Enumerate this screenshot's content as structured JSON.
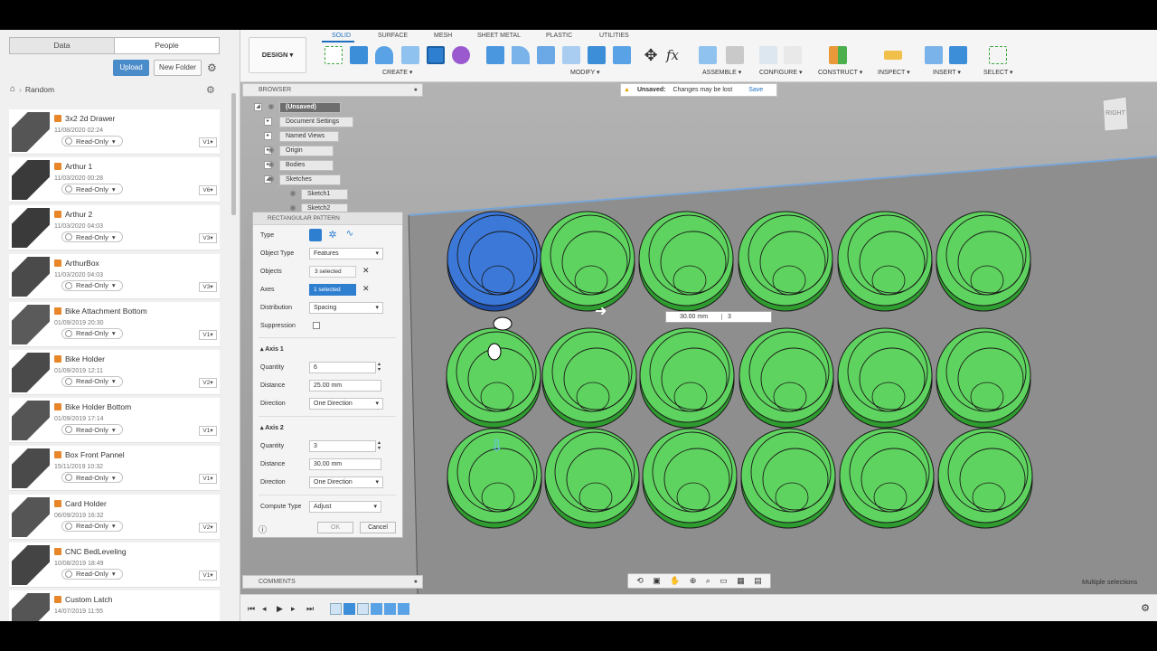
{
  "data_panel": {
    "tab_data": "Data",
    "tab_people": "People",
    "upload": "Upload",
    "new_folder": "New Folder",
    "breadcrumb": "Random",
    "files": [
      {
        "name": "3x2 2d Drawer",
        "date": "11/08/2020 02:24",
        "status": "Read-Only",
        "version": "V1"
      },
      {
        "name": "Arthur 1",
        "date": "11/03/2020 00:28",
        "status": "Read-Only",
        "version": "V6"
      },
      {
        "name": "Arthur 2",
        "date": "11/03/2020 04:03",
        "status": "Read-Only",
        "version": "V3"
      },
      {
        "name": "ArthurBox",
        "date": "11/03/2020 04:03",
        "status": "Read-Only",
        "version": "V3"
      },
      {
        "name": "Bike Attachment Bottom",
        "date": "01/09/2019 20:30",
        "status": "Read-Only",
        "version": "V1"
      },
      {
        "name": "Bike Holder",
        "date": "01/09/2019 12:11",
        "status": "Read-Only",
        "version": "V2"
      },
      {
        "name": "Bike Holder Bottom",
        "date": "01/09/2019 17:14",
        "status": "Read-Only",
        "version": "V1"
      },
      {
        "name": "Box Front Pannel",
        "date": "15/11/2019 10:32",
        "status": "Read-Only",
        "version": "V1"
      },
      {
        "name": "Card Holder",
        "date": "06/09/2019 16:32",
        "status": "Read-Only",
        "version": "V2"
      },
      {
        "name": "CNC BedLeveling",
        "date": "10/08/2019 18:49",
        "status": "Read-Only",
        "version": "V1"
      },
      {
        "name": "Custom Latch",
        "date": "14/07/2019 11:55",
        "status": "",
        "version": ""
      }
    ]
  },
  "toolbar": {
    "design": "DESIGN",
    "tabs": [
      "SOLID",
      "SURFACE",
      "MESH",
      "SHEET METAL",
      "PLASTIC",
      "UTILITIES"
    ],
    "groups": [
      "CREATE",
      "MODIFY",
      "ASSEMBLE",
      "CONFIGURE",
      "CONSTRUCT",
      "INSPECT",
      "INSERT",
      "SELECT"
    ]
  },
  "browser": {
    "title": "BROWSER",
    "nodes": [
      "(Unsaved)",
      "Document Settings",
      "Named Views",
      "Origin",
      "Bodies",
      "Sketches",
      "Sketch1",
      "Sketch2"
    ]
  },
  "pattern": {
    "title": "RECTANGULAR PATTERN",
    "type_label": "Type",
    "object_type_label": "Object Type",
    "object_type": "Features",
    "objects_label": "Objects",
    "objects": "3 selected",
    "axes_label": "Axes",
    "axes": "1 selected",
    "distribution_label": "Distribution",
    "distribution": "Spacing",
    "suppression_label": "Suppression",
    "axis1": "Axis 1",
    "axis2": "Axis 2",
    "quantity_label": "Quantity",
    "distance_label": "Distance",
    "direction_label": "Direction",
    "q1": "6",
    "d1": "25.00 mm",
    "dir1": "One Direction",
    "q2": "3",
    "d2": "30.00 mm",
    "dir2": "One Direction",
    "compute_label": "Compute Type",
    "compute": "Adjust",
    "ok": "OK",
    "cancel": "Cancel"
  },
  "unsaved": {
    "label": "Unsaved:",
    "msg": "Changes may be lost",
    "save": "Save"
  },
  "viewport": {
    "input_distance": "30.00 mm",
    "input_qty": "3",
    "status": "Multiple selections",
    "viewcube": "RIGHT"
  },
  "comments": "COMMENTS",
  "colors": {
    "accent": "#1e6fbf",
    "green": "#5fd35f",
    "selected_blue": "#2e6fd6"
  }
}
